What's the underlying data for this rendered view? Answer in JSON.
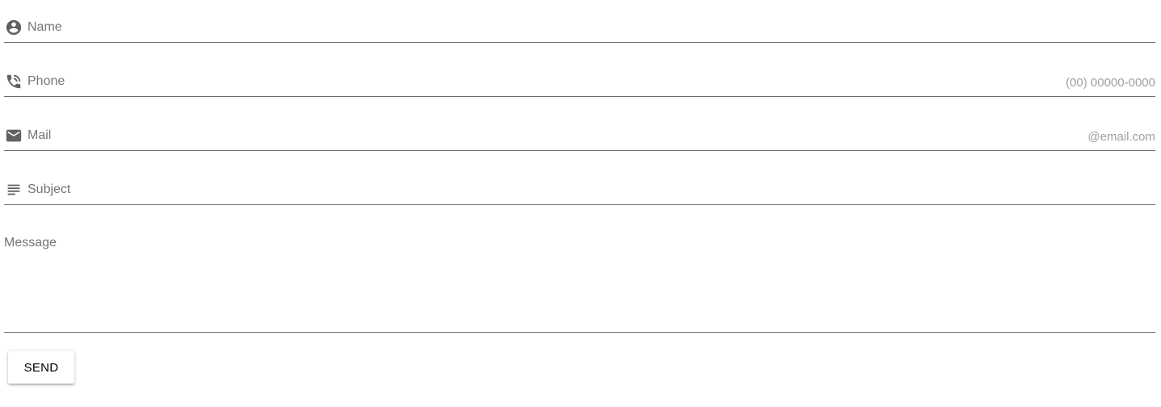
{
  "form": {
    "fields": {
      "name": {
        "label": "Name",
        "icon": "account-circle-icon",
        "value": ""
      },
      "phone": {
        "label": "Phone",
        "icon": "phone-icon",
        "value": "",
        "suffix": "(00) 00000-0000"
      },
      "mail": {
        "label": "Mail",
        "icon": "mail-icon",
        "value": "",
        "suffix": "@email.com"
      },
      "subject": {
        "label": "Subject",
        "icon": "subject-icon",
        "value": ""
      },
      "message": {
        "label": "Message",
        "value": ""
      }
    },
    "send_label": "SEND"
  },
  "colors": {
    "label": "#757575",
    "icon": "#616161",
    "suffix": "#9e9e9e",
    "underline": "#6d6d6d",
    "button_text": "#000000",
    "background": "#ffffff"
  }
}
